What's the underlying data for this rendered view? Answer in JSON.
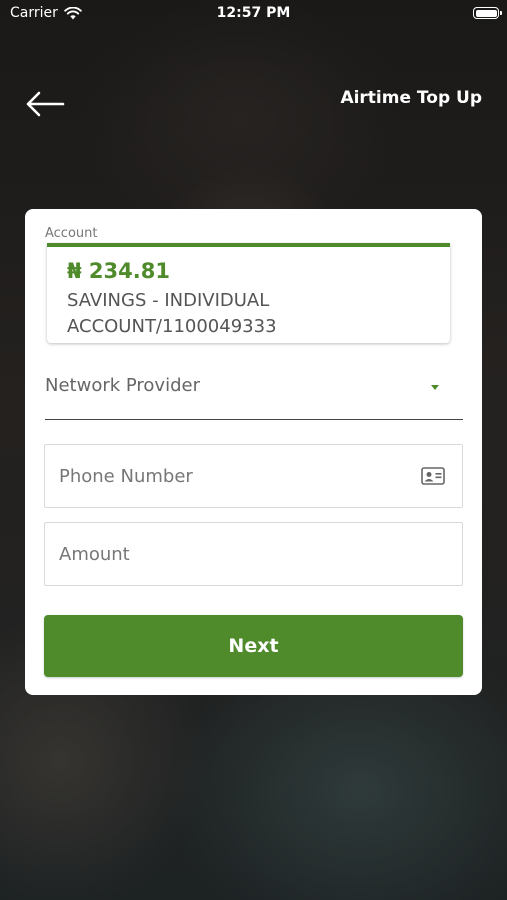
{
  "status_bar": {
    "carrier": "Carrier",
    "time": "12:57 PM"
  },
  "header": {
    "title": "Airtime Top Up"
  },
  "account": {
    "label": "Account",
    "balance": "₦ 234.81",
    "name": "SAVINGS - INDIVIDUAL ACCOUNT/1100049333"
  },
  "form": {
    "network_provider_label": "Network Provider",
    "phone_placeholder": "Phone Number",
    "amount_placeholder": "Amount",
    "next_label": "Next"
  },
  "colors": {
    "accent": "#4f8a2b"
  },
  "icons": [
    "wifi-icon",
    "battery-icon",
    "back-arrow-icon",
    "dropdown-caret-icon",
    "contact-card-icon"
  ]
}
